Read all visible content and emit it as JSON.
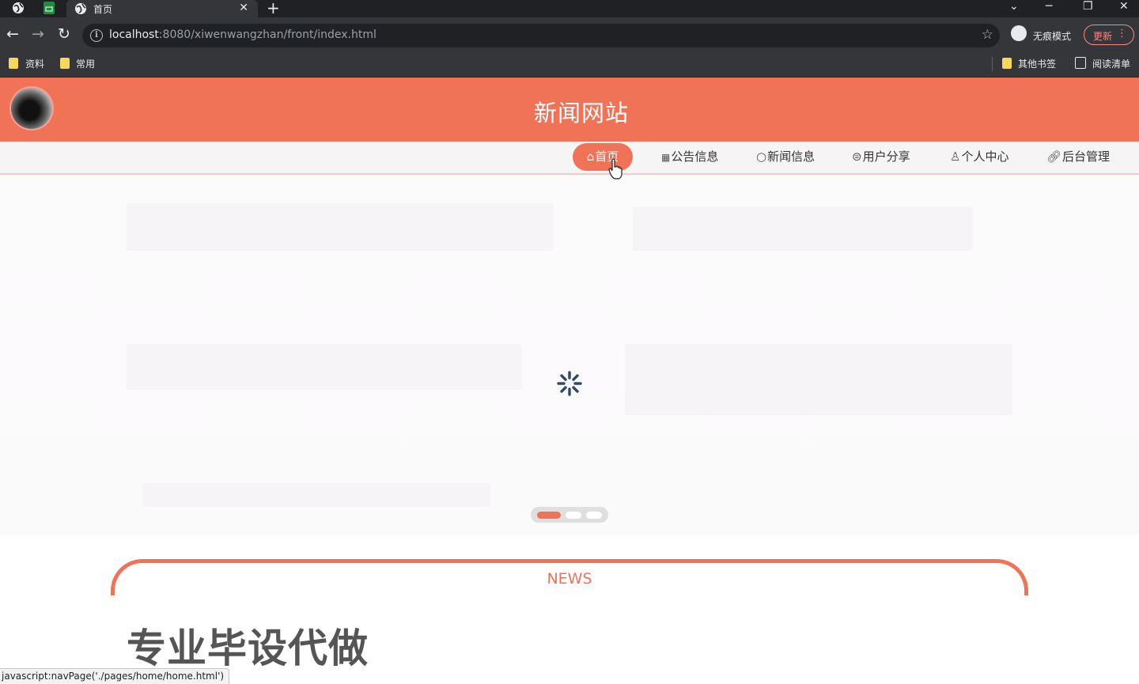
{
  "browser": {
    "tab_title": "首页",
    "url_host": "localhost",
    "url_rest": ":8080/xiwenwangzhan/front/index.html",
    "incognito_label": "无痕模式",
    "update_label": "更新",
    "bookmarks": [
      "资料",
      "常用"
    ],
    "other_bookmarks": "其他书签",
    "reading_list": "阅读清单",
    "status_url": "javascript:navPage('./pages/home/home.html')"
  },
  "site": {
    "title": "新闻网站",
    "nav": [
      {
        "icon": "home-icon",
        "label": "首页",
        "active": true
      },
      {
        "icon": "notice-icon",
        "label": "公告信息"
      },
      {
        "icon": "news-icon",
        "label": "新闻信息"
      },
      {
        "icon": "share-icon",
        "label": "用户分享"
      },
      {
        "icon": "user-icon",
        "label": "个人中心"
      },
      {
        "icon": "link-icon",
        "label": "后台管理"
      }
    ],
    "carousel": {
      "slides": 3,
      "active": 0
    },
    "section_title": "NEWS",
    "promo": "专业毕设代做"
  },
  "colors": {
    "accent": "#f07358",
    "nav_bg": "#f5f5f5",
    "chrome_dark": "#202124",
    "chrome": "#35363a"
  }
}
